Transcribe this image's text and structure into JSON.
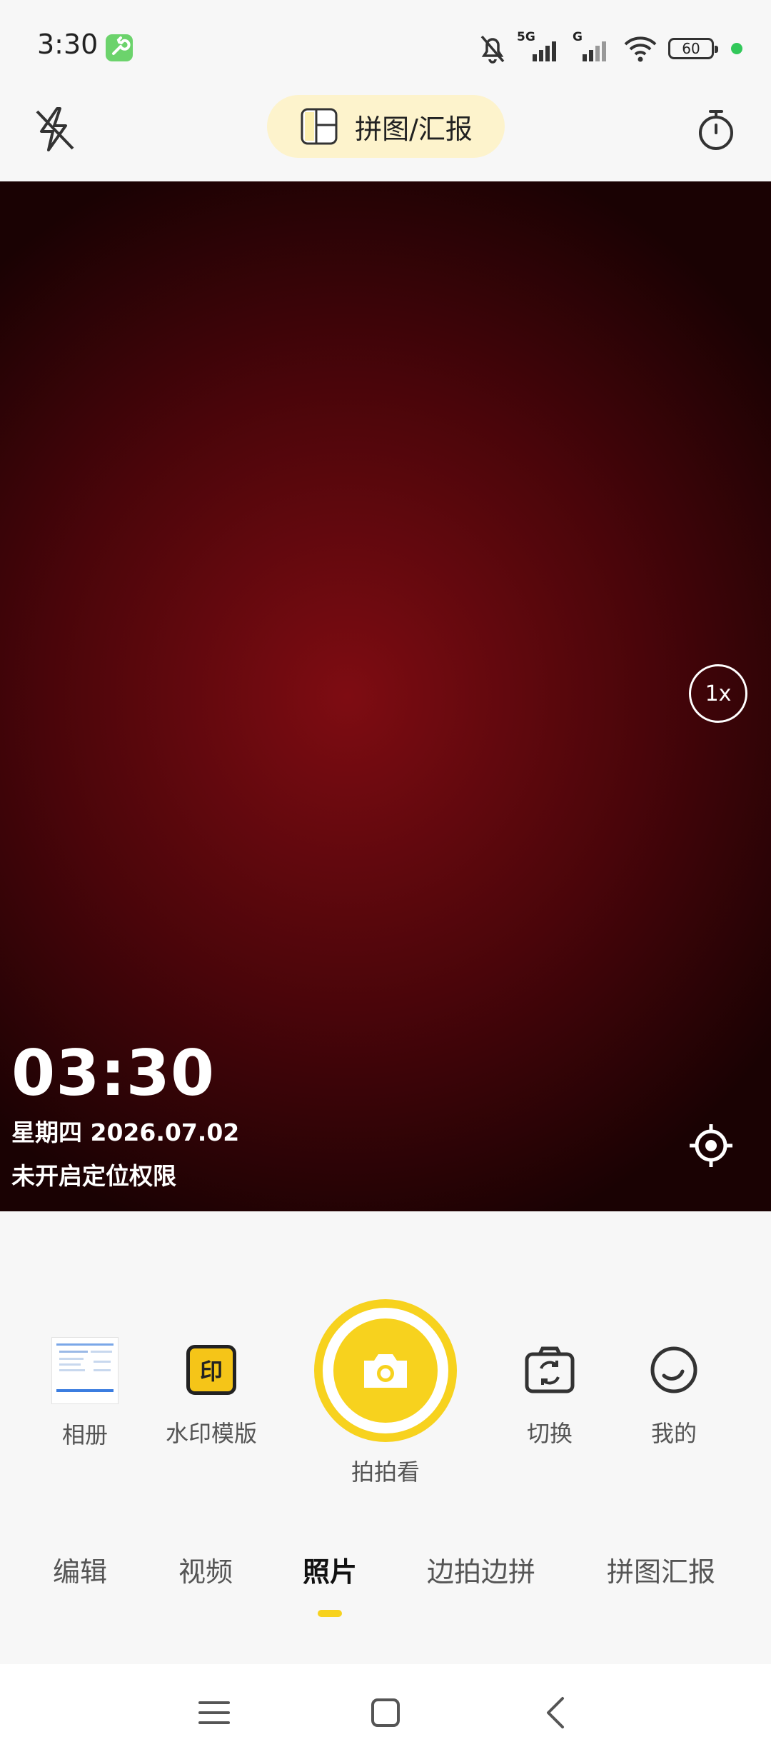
{
  "status_bar": {
    "time": "3:30",
    "network_label": "5G",
    "network_label_2": "G",
    "battery": "60"
  },
  "top_bar": {
    "collage_label": "拼图/汇报"
  },
  "viewfinder": {
    "zoom_label": "1x",
    "watermark_time": "03:30",
    "watermark_date": "星期四  2026.07.02",
    "watermark_location": "未开启定位权限"
  },
  "controls": {
    "album_label": "相册",
    "watermark_template_label": "水印模版",
    "watermark_icon_text": "印",
    "shutter_label": "拍拍看",
    "switch_label": "切换",
    "mine_label": "我的"
  },
  "mode_tabs": [
    {
      "label": "编辑",
      "active": false
    },
    {
      "label": "视频",
      "active": false
    },
    {
      "label": "照片",
      "active": true
    },
    {
      "label": "边拍边拼",
      "active": false
    },
    {
      "label": "拼图汇报",
      "active": false
    }
  ],
  "colors": {
    "accent": "#f7d21e",
    "pill_bg": "#fdf3cc",
    "viewfinder": "#7e0c12"
  }
}
